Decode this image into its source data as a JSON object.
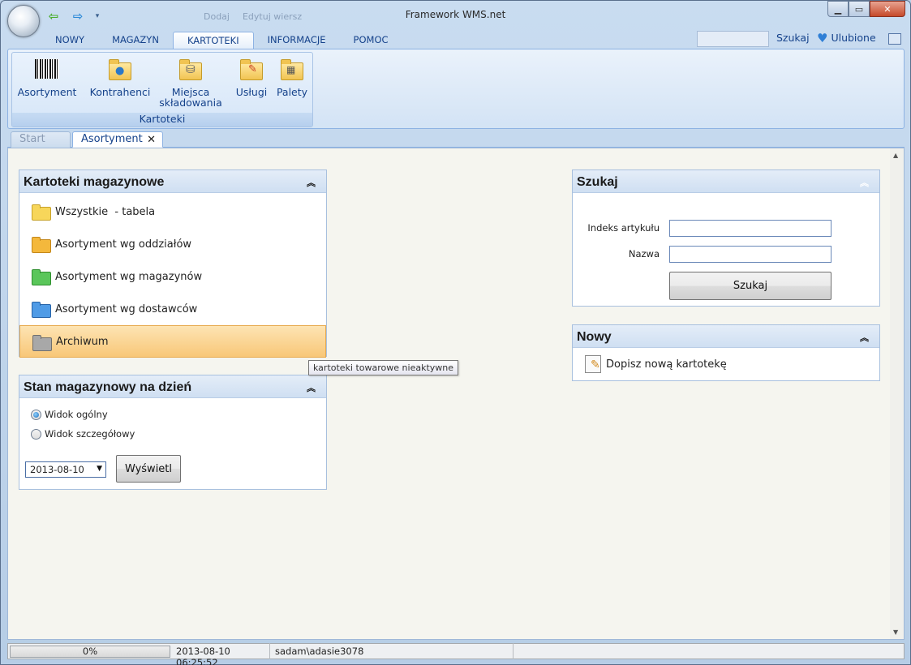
{
  "window": {
    "title": "Framework WMS.net",
    "qat_ghost_items": [
      "Dodaj",
      "Edytuj wiersz"
    ],
    "controls": [
      "minimize",
      "maximize",
      "close"
    ]
  },
  "menu_tabs": [
    {
      "label": "NOWY",
      "active": false
    },
    {
      "label": "MAGAZYN",
      "active": false
    },
    {
      "label": "KARTOTEKI",
      "active": true
    },
    {
      "label": "INFORMACJE",
      "active": false
    },
    {
      "label": "POMOC",
      "active": false
    }
  ],
  "top_search": {
    "value": "",
    "button": "Szukaj"
  },
  "favorites": {
    "label": "Ulubione"
  },
  "ribbon": {
    "group_label": "Kartoteki",
    "buttons": [
      {
        "label": "Asortyment",
        "icon": "barcode-icon"
      },
      {
        "label": "Kontrahenci",
        "icon": "folder-people-icon"
      },
      {
        "label1": "Miejsca",
        "label2": "składowania",
        "icon": "folder-database-icon"
      },
      {
        "label": "Usługi",
        "icon": "folder-pencil-icon"
      },
      {
        "label": "Palety",
        "icon": "folder-pallet-icon"
      }
    ]
  },
  "doc_tabs": [
    {
      "label": "Start",
      "active": false
    },
    {
      "label": "Asortyment",
      "active": true,
      "close": "✕"
    }
  ],
  "kartoteki_panel": {
    "title": "Kartoteki magazynowe",
    "collapse": "⌃",
    "items": [
      {
        "label": "Wszystkie  - tabela",
        "color": "#f7d65a"
      },
      {
        "label": "Asortyment wg oddziałów",
        "color": "#f4b83c"
      },
      {
        "label": "Asortyment wg magazynów",
        "color": "#5ac65a"
      },
      {
        "label": "Asortyment wg dostawców",
        "color": "#4f9be6"
      },
      {
        "label": "Archiwum",
        "color": "#a8a8a8",
        "selected": true
      }
    ],
    "tooltip": "kartoteki towarowe nieaktywne"
  },
  "stan_panel": {
    "title": "Stan magazynowy na dzień",
    "radio_general": "Widok ogólny",
    "radio_detailed": "Widok szczegółowy",
    "selected_radio": "general",
    "date": "2013-08-10",
    "show_button": "Wyświetl"
  },
  "search_panel": {
    "title": "Szukaj",
    "index_label": "Indeks artykułu",
    "index_value": "",
    "name_label": "Nazwa",
    "name_value": "",
    "button": "Szukaj"
  },
  "new_panel": {
    "title": "Nowy",
    "item": "Dopisz nową kartotekę"
  },
  "status_bar": {
    "progress_text": "0%",
    "progress_fraction": 0.0,
    "datetime": "2013-08-10 06:25:52",
    "user": "sadam\\adasie3078"
  },
  "colors": {
    "accent": "#15428b",
    "selection": "#f8c778",
    "panel_header": "#cfdff2"
  }
}
